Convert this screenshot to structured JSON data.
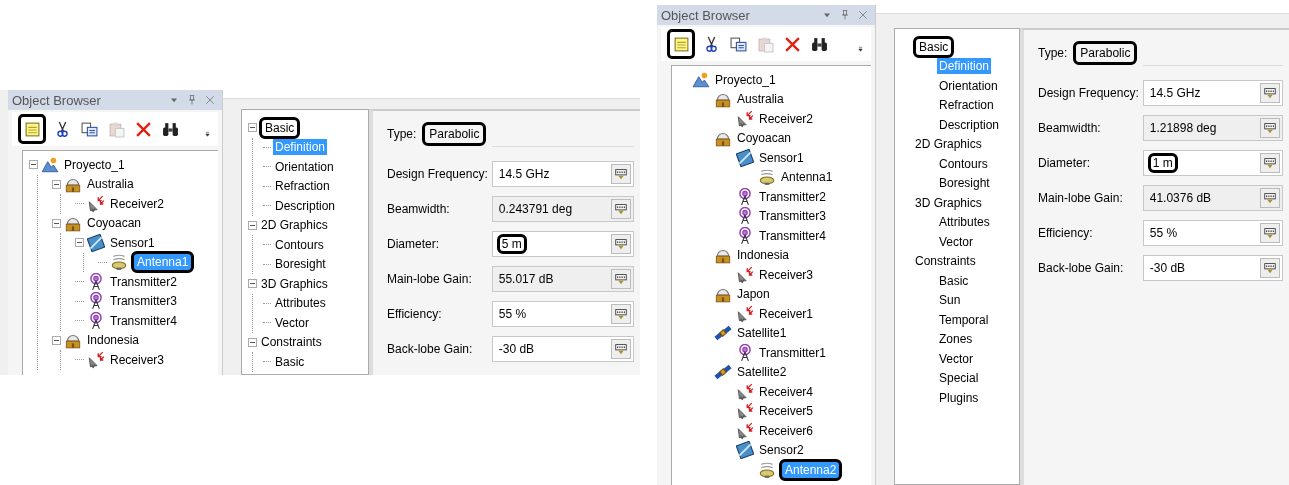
{
  "panels": [
    {
      "tree_lines": true,
      "object_browser": {
        "title": "Object Browser",
        "toolbar": [
          {
            "kind": "notes",
            "highlighted": true,
            "disabled": false
          },
          {
            "kind": "cut",
            "highlighted": false,
            "disabled": false
          },
          {
            "kind": "copy",
            "highlighted": false,
            "disabled": false
          },
          {
            "kind": "paste",
            "highlighted": false,
            "disabled": true
          },
          {
            "kind": "delete",
            "highlighted": false,
            "disabled": false
          },
          {
            "kind": "find",
            "highlighted": false,
            "disabled": false
          }
        ],
        "tree": [
          {
            "label": "Proyecto_1",
            "kind": "project",
            "selected": false,
            "highlighted": false,
            "children": [
              {
                "label": "Australia",
                "kind": "site",
                "selected": false,
                "highlighted": false,
                "children": [
                  {
                    "label": "Receiver2",
                    "kind": "receiver",
                    "selected": false,
                    "highlighted": false
                  }
                ]
              },
              {
                "label": "Coyoacan",
                "kind": "site",
                "selected": false,
                "highlighted": false,
                "children": [
                  {
                    "label": "Sensor1",
                    "kind": "sensor",
                    "selected": false,
                    "highlighted": false,
                    "children": [
                      {
                        "label": "Antenna1",
                        "kind": "antenna",
                        "selected": true,
                        "highlighted": true
                      }
                    ]
                  },
                  {
                    "label": "Transmitter2",
                    "kind": "transmitter",
                    "selected": false,
                    "highlighted": false
                  },
                  {
                    "label": "Transmitter3",
                    "kind": "transmitter",
                    "selected": false,
                    "highlighted": false
                  },
                  {
                    "label": "Transmitter4",
                    "kind": "transmitter",
                    "selected": false,
                    "highlighted": false
                  }
                ]
              },
              {
                "label": "Indonesia",
                "kind": "site",
                "selected": false,
                "highlighted": false,
                "children": [
                  {
                    "label": "Receiver3",
                    "kind": "receiver",
                    "selected": false,
                    "highlighted": false
                  }
                ]
              }
            ]
          }
        ]
      },
      "pages": [
        {
          "label": "Basic",
          "selected": false,
          "highlighted": true,
          "children": [
            {
              "label": "Definition",
              "selected": true,
              "highlighted": false
            },
            {
              "label": "Orientation",
              "selected": false,
              "highlighted": false
            },
            {
              "label": "Refraction",
              "selected": false,
              "highlighted": false
            },
            {
              "label": "Description",
              "selected": false,
              "highlighted": false
            }
          ]
        },
        {
          "label": "2D Graphics",
          "selected": false,
          "highlighted": false,
          "children": [
            {
              "label": "Contours",
              "selected": false,
              "highlighted": false
            },
            {
              "label": "Boresight",
              "selected": false,
              "highlighted": false
            }
          ]
        },
        {
          "label": "3D Graphics",
          "selected": false,
          "highlighted": false,
          "children": [
            {
              "label": "Attributes",
              "selected": false,
              "highlighted": false
            },
            {
              "label": "Vector",
              "selected": false,
              "highlighted": false
            }
          ]
        },
        {
          "label": "Constraints",
          "selected": false,
          "highlighted": false,
          "children": [
            {
              "label": "Basic",
              "selected": false,
              "highlighted": false
            }
          ]
        }
      ],
      "properties": {
        "type_label": "Type:",
        "type_value": "Parabolic",
        "type_highlighted": true,
        "fields": [
          {
            "label": "Design Frequency:",
            "value": "14.5 GHz",
            "disabled": false,
            "highlighted": false
          },
          {
            "label": "Beamwidth:",
            "value": "0.243791 deg",
            "disabled": true,
            "highlighted": false
          },
          {
            "label": "Diameter:",
            "value": "5 m",
            "disabled": false,
            "highlighted": true
          },
          {
            "label": "Main-lobe Gain:",
            "value": "55.017 dB",
            "disabled": true,
            "highlighted": false
          },
          {
            "label": "Efficiency:",
            "value": "55 %",
            "disabled": false,
            "highlighted": false
          },
          {
            "label": "Back-lobe Gain:",
            "value": "-30 dB",
            "disabled": false,
            "highlighted": false
          }
        ]
      }
    },
    {
      "tree_lines": false,
      "object_browser": {
        "title": "Object Browser",
        "toolbar": [
          {
            "kind": "notes",
            "highlighted": true,
            "disabled": false
          },
          {
            "kind": "cut",
            "highlighted": false,
            "disabled": false
          },
          {
            "kind": "copy",
            "highlighted": false,
            "disabled": false
          },
          {
            "kind": "paste",
            "highlighted": false,
            "disabled": true
          },
          {
            "kind": "delete",
            "highlighted": false,
            "disabled": false
          },
          {
            "kind": "find",
            "highlighted": false,
            "disabled": false
          }
        ],
        "tree": [
          {
            "label": "Proyecto_1",
            "kind": "project",
            "selected": false,
            "highlighted": false,
            "children": [
              {
                "label": "Australia",
                "kind": "site",
                "selected": false,
                "highlighted": false,
                "children": [
                  {
                    "label": "Receiver2",
                    "kind": "receiver",
                    "selected": false,
                    "highlighted": false
                  }
                ]
              },
              {
                "label": "Coyoacan",
                "kind": "site",
                "selected": false,
                "highlighted": false,
                "children": [
                  {
                    "label": "Sensor1",
                    "kind": "sensor",
                    "selected": false,
                    "highlighted": false,
                    "children": [
                      {
                        "label": "Antenna1",
                        "kind": "antenna",
                        "selected": false,
                        "highlighted": false
                      }
                    ]
                  },
                  {
                    "label": "Transmitter2",
                    "kind": "transmitter",
                    "selected": false,
                    "highlighted": false
                  },
                  {
                    "label": "Transmitter3",
                    "kind": "transmitter",
                    "selected": false,
                    "highlighted": false
                  },
                  {
                    "label": "Transmitter4",
                    "kind": "transmitter",
                    "selected": false,
                    "highlighted": false
                  }
                ]
              },
              {
                "label": "Indonesia",
                "kind": "site",
                "selected": false,
                "highlighted": false,
                "children": [
                  {
                    "label": "Receiver3",
                    "kind": "receiver",
                    "selected": false,
                    "highlighted": false
                  }
                ]
              },
              {
                "label": "Japon",
                "kind": "site",
                "selected": false,
                "highlighted": false,
                "children": [
                  {
                    "label": "Receiver1",
                    "kind": "receiver",
                    "selected": false,
                    "highlighted": false
                  }
                ]
              },
              {
                "label": "Satellite1",
                "kind": "satellite",
                "selected": false,
                "highlighted": false,
                "children": [
                  {
                    "label": "Transmitter1",
                    "kind": "transmitter",
                    "selected": false,
                    "highlighted": false
                  }
                ]
              },
              {
                "label": "Satellite2",
                "kind": "satellite",
                "selected": false,
                "highlighted": false,
                "children": [
                  {
                    "label": "Receiver4",
                    "kind": "receiver",
                    "selected": false,
                    "highlighted": false
                  },
                  {
                    "label": "Receiver5",
                    "kind": "receiver",
                    "selected": false,
                    "highlighted": false
                  },
                  {
                    "label": "Receiver6",
                    "kind": "receiver",
                    "selected": false,
                    "highlighted": false
                  },
                  {
                    "label": "Sensor2",
                    "kind": "sensor",
                    "selected": false,
                    "highlighted": false,
                    "children": [
                      {
                        "label": "Antenna2",
                        "kind": "antenna",
                        "selected": true,
                        "highlighted": true
                      }
                    ]
                  }
                ]
              }
            ]
          }
        ]
      },
      "pages": [
        {
          "label": "Basic",
          "selected": false,
          "highlighted": true,
          "children": [
            {
              "label": "Definition",
              "selected": true,
              "highlighted": false
            },
            {
              "label": "Orientation",
              "selected": false,
              "highlighted": false
            },
            {
              "label": "Refraction",
              "selected": false,
              "highlighted": false
            },
            {
              "label": "Description",
              "selected": false,
              "highlighted": false
            }
          ]
        },
        {
          "label": "2D Graphics",
          "selected": false,
          "highlighted": false,
          "children": [
            {
              "label": "Contours",
              "selected": false,
              "highlighted": false
            },
            {
              "label": "Boresight",
              "selected": false,
              "highlighted": false
            }
          ]
        },
        {
          "label": "3D Graphics",
          "selected": false,
          "highlighted": false,
          "children": [
            {
              "label": "Attributes",
              "selected": false,
              "highlighted": false
            },
            {
              "label": "Vector",
              "selected": false,
              "highlighted": false
            }
          ]
        },
        {
          "label": "Constraints",
          "selected": false,
          "highlighted": false,
          "children": [
            {
              "label": "Basic",
              "selected": false,
              "highlighted": false
            },
            {
              "label": "Sun",
              "selected": false,
              "highlighted": false
            },
            {
              "label": "Temporal",
              "selected": false,
              "highlighted": false
            },
            {
              "label": "Zones",
              "selected": false,
              "highlighted": false
            },
            {
              "label": "Vector",
              "selected": false,
              "highlighted": false
            },
            {
              "label": "Special",
              "selected": false,
              "highlighted": false
            },
            {
              "label": "Plugins",
              "selected": false,
              "highlighted": false
            }
          ]
        }
      ],
      "properties": {
        "type_label": "Type:",
        "type_value": "Parabolic",
        "type_highlighted": true,
        "fields": [
          {
            "label": "Design Frequency:",
            "value": "14.5 GHz",
            "disabled": false,
            "highlighted": false
          },
          {
            "label": "Beamwidth:",
            "value": "1.21898 deg",
            "disabled": true,
            "highlighted": false
          },
          {
            "label": "Diameter:",
            "value": "1 m",
            "disabled": false,
            "highlighted": true
          },
          {
            "label": "Main-lobe Gain:",
            "value": "41.0376 dB",
            "disabled": true,
            "highlighted": false
          },
          {
            "label": "Efficiency:",
            "value": "55 %",
            "disabled": false,
            "highlighted": false
          },
          {
            "label": "Back-lobe Gain:",
            "value": "-30 dB",
            "disabled": false,
            "highlighted": false
          }
        ]
      }
    }
  ]
}
